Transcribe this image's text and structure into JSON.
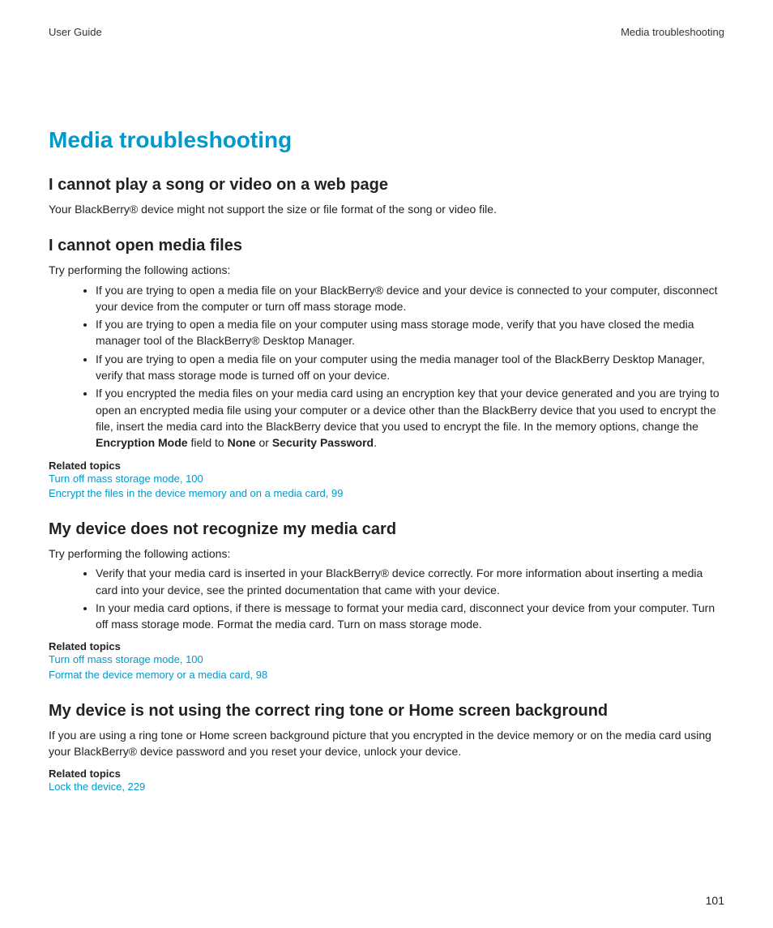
{
  "header": {
    "left": "User Guide",
    "right": "Media troubleshooting"
  },
  "title": "Media troubleshooting",
  "s1": {
    "heading": "I cannot play a song or video on a web page",
    "para": "Your BlackBerry® device might not support the size or file format of the song or video file."
  },
  "s2": {
    "heading": "I cannot open media files",
    "intro": "Try performing the following actions:",
    "b1": "If you are trying to open a media file on your BlackBerry® device and your device is connected to your computer, disconnect your device from the computer or turn off mass storage mode.",
    "b2": "If you are trying to open a media file on your computer using mass storage mode, verify that you have closed the media manager tool of the BlackBerry® Desktop Manager.",
    "b3": "If you are trying to open a media file on your computer using the media manager tool of the BlackBerry Desktop Manager, verify that mass storage mode is turned off on your device.",
    "b4a": "If you encrypted the media files on your media card using an encryption key that your device generated and you are trying to open an encrypted media file using your computer or a device other than the BlackBerry device that you used to encrypt the file, insert the media card into the BlackBerry device that you used to encrypt the file. In the memory options, change the ",
    "b4enc": "Encryption Mode",
    "b4b": " field to ",
    "b4none": "None",
    "b4c": " or ",
    "b4sec": "Security Password",
    "b4d": ".",
    "related_label": "Related topics",
    "link1": "Turn off mass storage mode, 100",
    "link2": "Encrypt the files in the device memory and on a media card, 99"
  },
  "s3": {
    "heading": "My device does not recognize my media card",
    "intro": "Try performing the following actions:",
    "b1": "Verify that your media card is inserted in your BlackBerry® device correctly. For more information about inserting a media card into your device, see the printed documentation that came with your device.",
    "b2": "In your media card options, if there is message to format your media card, disconnect your device from your computer. Turn off mass storage mode. Format the media card. Turn on mass storage mode.",
    "related_label": "Related topics",
    "link1": "Turn off mass storage mode, 100",
    "link2": "Format the device memory or a media card, 98"
  },
  "s4": {
    "heading": "My device is not using the correct ring tone or Home screen background",
    "para": "If you are using a ring tone or Home screen background picture that you encrypted in the device memory or on the media card using your BlackBerry® device password and you reset your device, unlock your device.",
    "related_label": "Related topics",
    "link1": "Lock the device, 229"
  },
  "page_number": "101"
}
